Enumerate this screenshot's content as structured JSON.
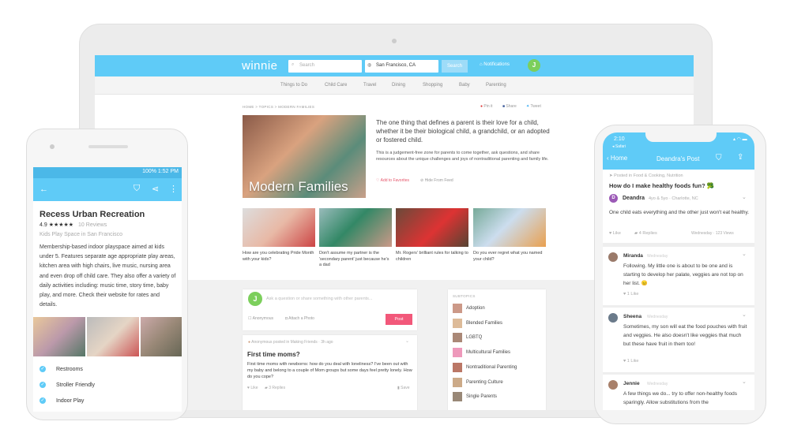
{
  "web": {
    "logo": "winnie",
    "search_placeholder": "Search",
    "location": "San Francisco, CA",
    "search_button": "Search",
    "notifications": "Notifications",
    "avatar": "J",
    "nav": [
      "Things to Do",
      "Child Care",
      "Travel",
      "Dining",
      "Shopping",
      "Baby",
      "Parenting"
    ],
    "breadcrumb": "HOME > TOPICS > MODERN FAMILIES",
    "share": {
      "pin": "Pin it",
      "share": "Share",
      "tweet": "Tweet"
    },
    "hero_title": "Modern Families",
    "lead": "The one thing that defines a parent is their love for a child, whether it be their biological child, a grandchild, or an adopted or fostered child.",
    "description": "This is a judgement-free zone for parents to come together, ask questions, and share resources about the unique challenges and joys of nontraditional parenting and family life.",
    "add_favorites": "Add to Favorites",
    "hide_feed": "Hide From Feed",
    "articles": [
      "How are you celebrating Pride Month with your kids?",
      "Don't assume my partner is the 'secondary parent' just because he's a dad",
      "Mr. Rogers' brilliant rules for talking to children",
      "Do you ever regret what you named your child?"
    ],
    "composer": {
      "placeholder": "Ask a question or share something with other parents...",
      "anonymous": "Anonymous",
      "attach": "Attach a Photo",
      "post": "Post"
    },
    "post": {
      "meta": "Anonymous posted in Making Friends · 3h ago",
      "title": "First time moms?",
      "body": "First time moms with newborns: how do you deal with loneliness? I've been out with my baby and belong to a couple of Mom groups but some days feel pretty lonely. How do you cope?",
      "like": "Like",
      "replies": "3 Replies",
      "save": "Save"
    },
    "subtopics_label": "SUBTOPICS",
    "subtopics": [
      "Adoption",
      "Blended Families",
      "LGBTQ",
      "Multicultural Families",
      "Nontraditional Parenting",
      "Parenting Culture",
      "Single Parents"
    ]
  },
  "android": {
    "status": "100%  1:52 PM",
    "title": "Recess Urban Recreation",
    "rating": "4.9",
    "stars": 5,
    "reviews": "10 Reviews",
    "category": "Kids Play Space in San Francisco",
    "description": "Membership-based indoor playspace aimed at kids under 5. Features separate age appropriate play areas, kitchen area with high chairs, live music, nursing area and even drop off child care. They also offer a variety of daily activities including: music time, story time, baby play, and more. Check their website for rates and details.",
    "amenities": [
      "Restrooms",
      "Stroller Friendly",
      "Indoor Play"
    ]
  },
  "iphone": {
    "time": "2:10",
    "back_app": "◂ Safari",
    "back": "Home",
    "title": "Deandra's Post",
    "posted_in": "Posted in Food & Cooking, Nutrition",
    "question": "How do I make healthy foods fun? 🥦",
    "author": "Deandra",
    "author_initial": "D",
    "author_meta": "4yo & 5yo · Charlotte, NC",
    "body": "One child eats everything and the other just won't eat healthy.",
    "like": "Like",
    "replies": "4 Replies",
    "stats": "Wednesday · 123 Views",
    "comments": [
      {
        "name": "Miranda",
        "time": "Wednesday",
        "text": "Following. My little one is about to be one and is starting to develop her palate, veggies are not top on her list. 😑",
        "likes": "1 Like"
      },
      {
        "name": "Sheena",
        "time": "Wednesday",
        "text": "Sometimes, my son will eat the food pouches with fruit and veggies. He also doesn't like veggies that much but these have fruit in them too!",
        "likes": "1 Like"
      },
      {
        "name": "Jennie",
        "time": "Wednesday",
        "text": "A few things we do... try to offer non-healthy foods sparingly. Allow substitutions from the"
      }
    ]
  },
  "colors": {
    "brand": "#5fcbf7",
    "post": "#f2587a",
    "avatar": "#7ccf5c"
  }
}
